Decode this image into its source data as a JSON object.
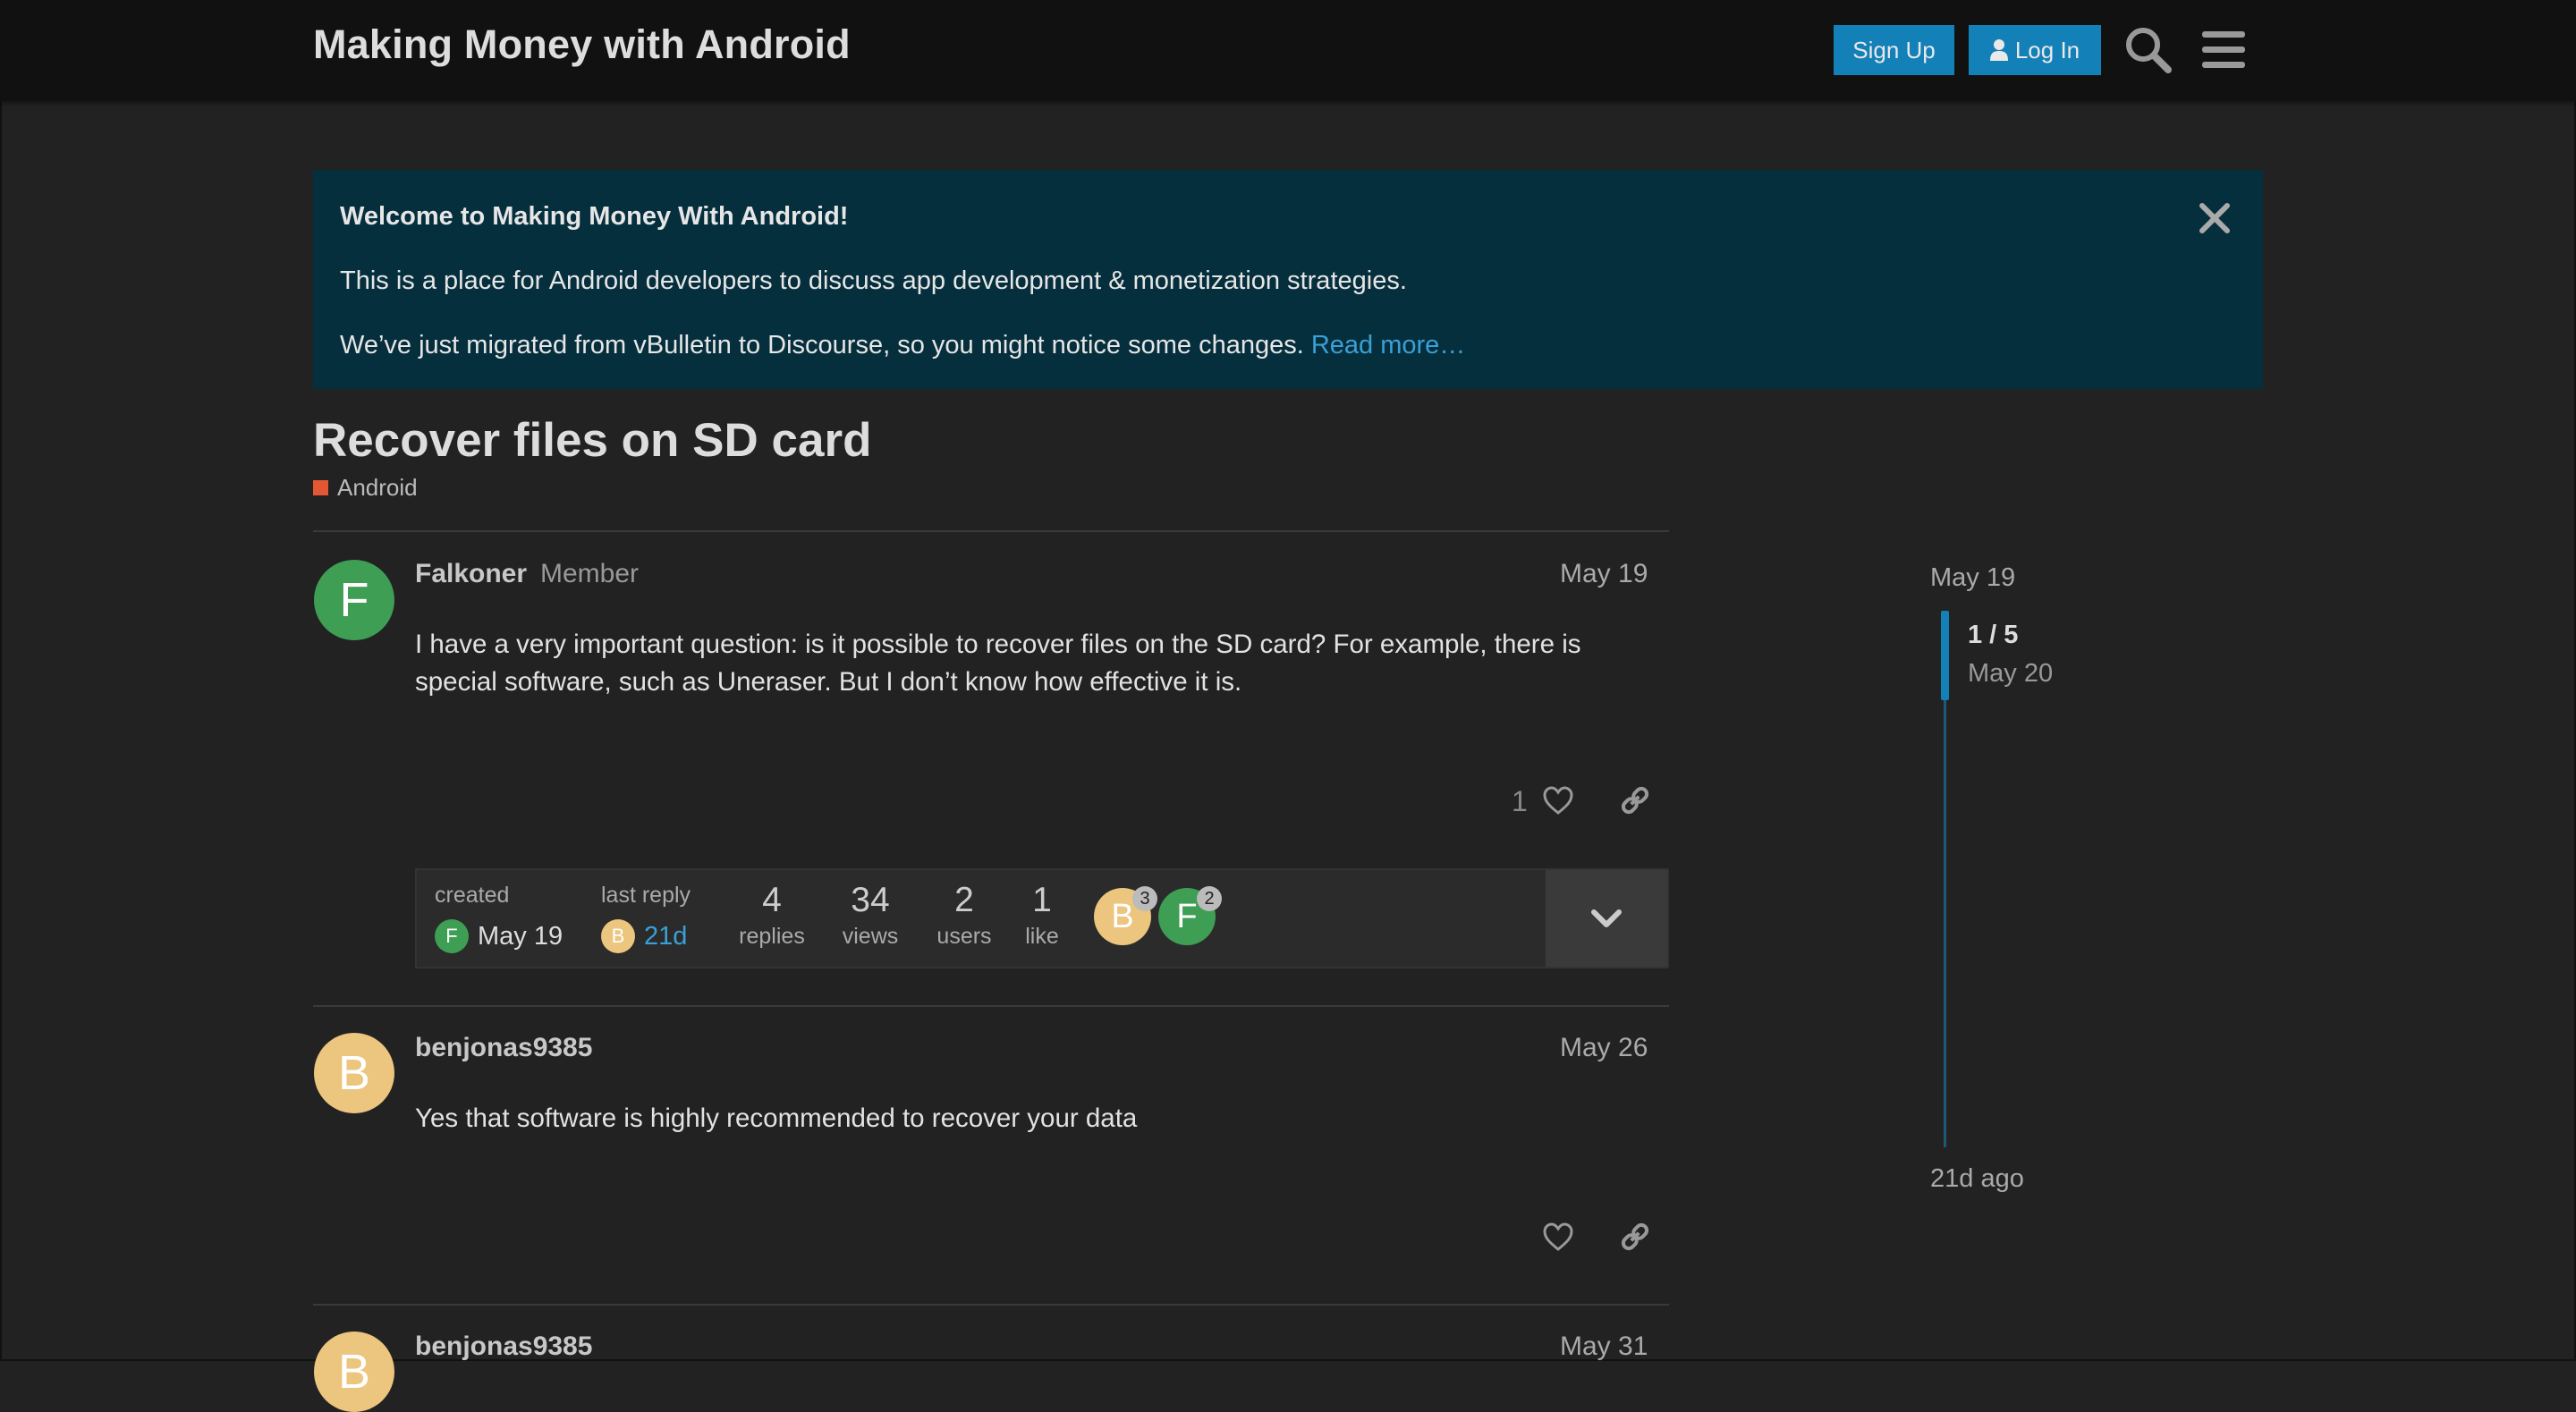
{
  "header": {
    "site_title": "Making Money with Android",
    "signup_label": "Sign Up",
    "login_label": "Log In"
  },
  "banner": {
    "title": "Welcome to Making Money With Android!",
    "line1": "This is a place for Android developers to discuss app development & monetization strategies.",
    "line2": "We’ve just migrated from vBulletin to Discourse, so you might notice some changes.",
    "link": "Read more…"
  },
  "topic": {
    "title": "Recover files on SD card",
    "category": "Android",
    "category_color": "#e45735"
  },
  "posts": [
    {
      "username": "Falkoner",
      "user_title": "Member",
      "avatar_letter": "F",
      "date": "May 19",
      "body": "I have a very important question: is it possible to recover files on the SD card? For example, there is special software, such as Uneraser. But I don’t know how effective it is.",
      "likes": "1"
    },
    {
      "username": "benjonas9385",
      "avatar_letter": "B",
      "date": "May 26",
      "body": "Yes that software is highly recommended to recover your data"
    },
    {
      "username": "benjonas9385",
      "avatar_letter": "B",
      "date": "May 31"
    }
  ],
  "topic_map": {
    "created_label": "created",
    "created_avatar": "F",
    "created_date": "May 19",
    "last_reply_label": "last reply",
    "last_reply_avatar": "B",
    "last_reply_date": "21d",
    "replies": "4",
    "replies_label": "replies",
    "views": "34",
    "views_label": "views",
    "users": "2",
    "users_label": "users",
    "likes": "1",
    "likes_label": "like",
    "participants": [
      {
        "letter": "B",
        "count": "3"
      },
      {
        "letter": "F",
        "count": "2"
      }
    ]
  },
  "timeline": {
    "start_date": "May 19",
    "position": "1 / 5",
    "position_date": "May 20",
    "end": "21d ago"
  },
  "colors": {
    "header_bg": "#111111",
    "page_bg": "#222222",
    "banner_bg": "#062f3e",
    "primary_button": "#1480b8",
    "link": "#3aa0d6"
  }
}
